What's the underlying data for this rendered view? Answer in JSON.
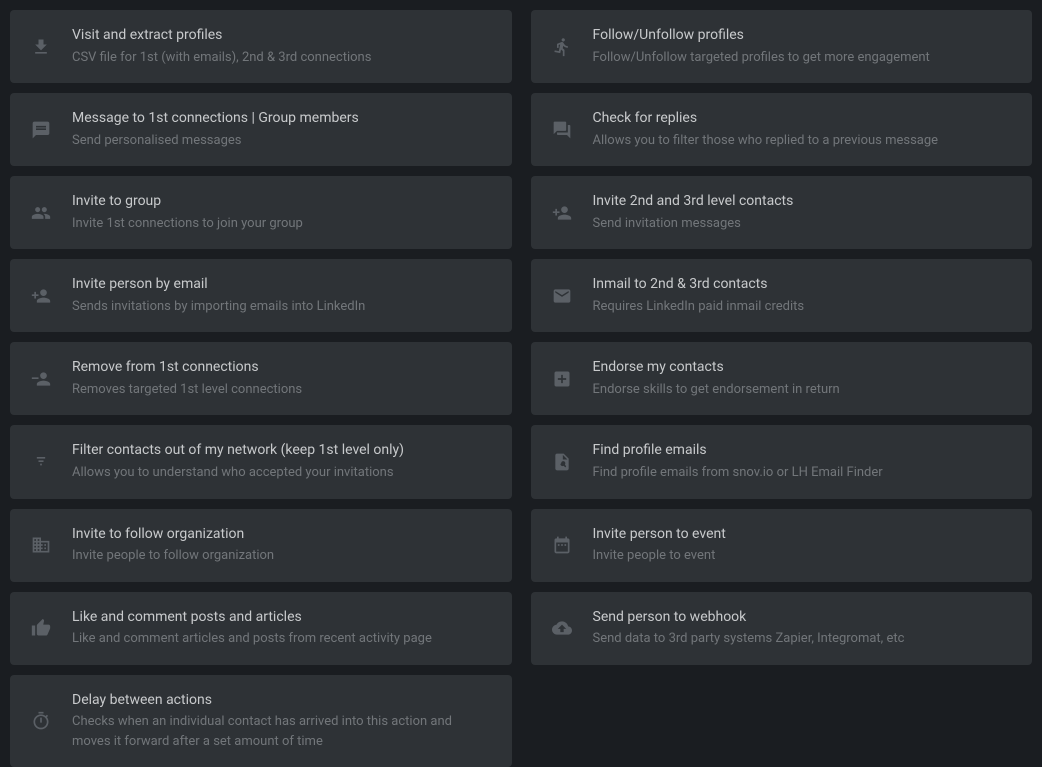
{
  "cards": {
    "left": [
      {
        "id": "visit-extract",
        "icon": "download",
        "title": "Visit and extract profiles",
        "desc": "CSV file for 1st (with emails), 2nd & 3rd connections"
      },
      {
        "id": "message-1st",
        "icon": "message",
        "title": "Message to 1st connections | Group members",
        "desc": "Send personalised messages"
      },
      {
        "id": "invite-group",
        "icon": "group",
        "title": "Invite to group",
        "desc": "Invite 1st connections to join your group"
      },
      {
        "id": "invite-email",
        "icon": "person-add",
        "title": "Invite person by email",
        "desc": "Sends invitations by importing emails into LinkedIn"
      },
      {
        "id": "remove-1st",
        "icon": "person-remove",
        "title": "Remove from 1st connections",
        "desc": "Removes targeted 1st level connections"
      },
      {
        "id": "filter-contacts",
        "icon": "filter",
        "title": "Filter contacts out of my network (keep 1st level only)",
        "desc": "Allows you to understand who accepted your invitations"
      },
      {
        "id": "invite-org",
        "icon": "building",
        "title": "Invite to follow organization",
        "desc": "Invite people to follow organization"
      },
      {
        "id": "like-comment",
        "icon": "thumb-up",
        "title": "Like and comment posts and articles",
        "desc": "Like and comment articles and posts from recent activity page"
      },
      {
        "id": "delay",
        "icon": "timer",
        "title": "Delay between actions",
        "desc": "Checks when an individual contact has arrived into this action and moves it forward after a set amount of time"
      }
    ],
    "right": [
      {
        "id": "follow-unfollow",
        "icon": "run",
        "title": "Follow/Unfollow profiles",
        "desc": "Follow/Unfollow targeted profiles to get more engagement"
      },
      {
        "id": "check-replies",
        "icon": "forum",
        "title": "Check for replies",
        "desc": "Allows you to filter those who replied to a previous message"
      },
      {
        "id": "invite-2nd-3rd",
        "icon": "person-add",
        "title": "Invite 2nd and 3rd level contacts",
        "desc": "Send invitation messages"
      },
      {
        "id": "inmail",
        "icon": "mail",
        "title": "Inmail to 2nd & 3rd contacts",
        "desc": "Requires LinkedIn paid inmail credits"
      },
      {
        "id": "endorse",
        "icon": "plus-box",
        "title": "Endorse my contacts",
        "desc": "Endorse skills to get endorsement in return"
      },
      {
        "id": "find-emails",
        "icon": "file-search",
        "title": "Find profile emails",
        "desc": "Find profile emails from snov.io or LH Email Finder"
      },
      {
        "id": "invite-event",
        "icon": "calendar",
        "title": "Invite person to event",
        "desc": "Invite people to event"
      },
      {
        "id": "webhook",
        "icon": "cloud-upload",
        "title": "Send person to webhook",
        "desc": "Send data to 3rd party systems Zapier, Integromat, etc"
      }
    ]
  }
}
